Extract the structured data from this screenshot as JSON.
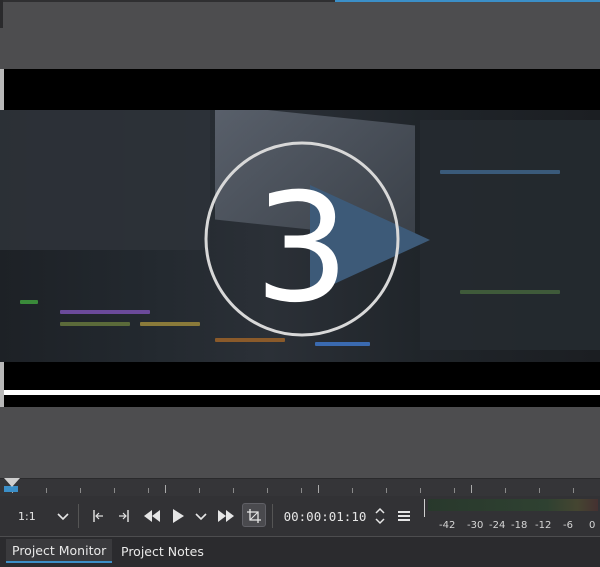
{
  "monitor": {
    "countdown_number": "3"
  },
  "toolbar": {
    "zoom_value": "1:1",
    "timecode": "00:00:01:10",
    "icons": [
      "chevron-down-icon",
      "set-zone-in-icon",
      "set-zone-out-icon",
      "rewind-icon",
      "play-icon",
      "chevron-down-icon",
      "fast-forward-icon",
      "crop-icon",
      "spin-up-down-icon",
      "menu-icon"
    ]
  },
  "audio_meter": {
    "scale": [
      "-42",
      "-30",
      "-24",
      "-18",
      "-12",
      "-6",
      "0"
    ]
  },
  "tabs": [
    {
      "label": "Project Monitor",
      "active": true
    },
    {
      "label": "Project Notes",
      "active": false
    }
  ],
  "colors": {
    "accent": "#3b8fc8",
    "panel": "#323235",
    "background": "#4d4d4f"
  }
}
